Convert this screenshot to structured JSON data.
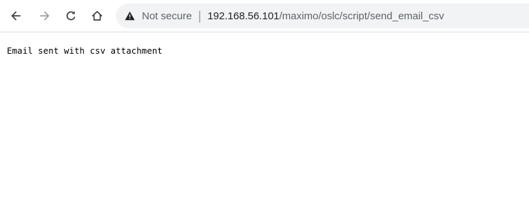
{
  "toolbar": {
    "back_icon": "arrow-left-icon",
    "forward_icon": "arrow-right-icon",
    "reload_icon": "reload-icon",
    "home_icon": "home-icon"
  },
  "omnibox": {
    "security_icon": "warning-triangle-icon",
    "security_text": "Not secure",
    "separator": "|",
    "url_host": "192.168.56.101",
    "url_path": "/maximo/oslc/script/send_email_csv"
  },
  "page": {
    "body_text": "Email sent with csv attachment"
  },
  "colors": {
    "omnibox_bg": "#f1f3f4",
    "icon_active": "#3c4043",
    "icon_disabled": "#9aa0a6"
  }
}
